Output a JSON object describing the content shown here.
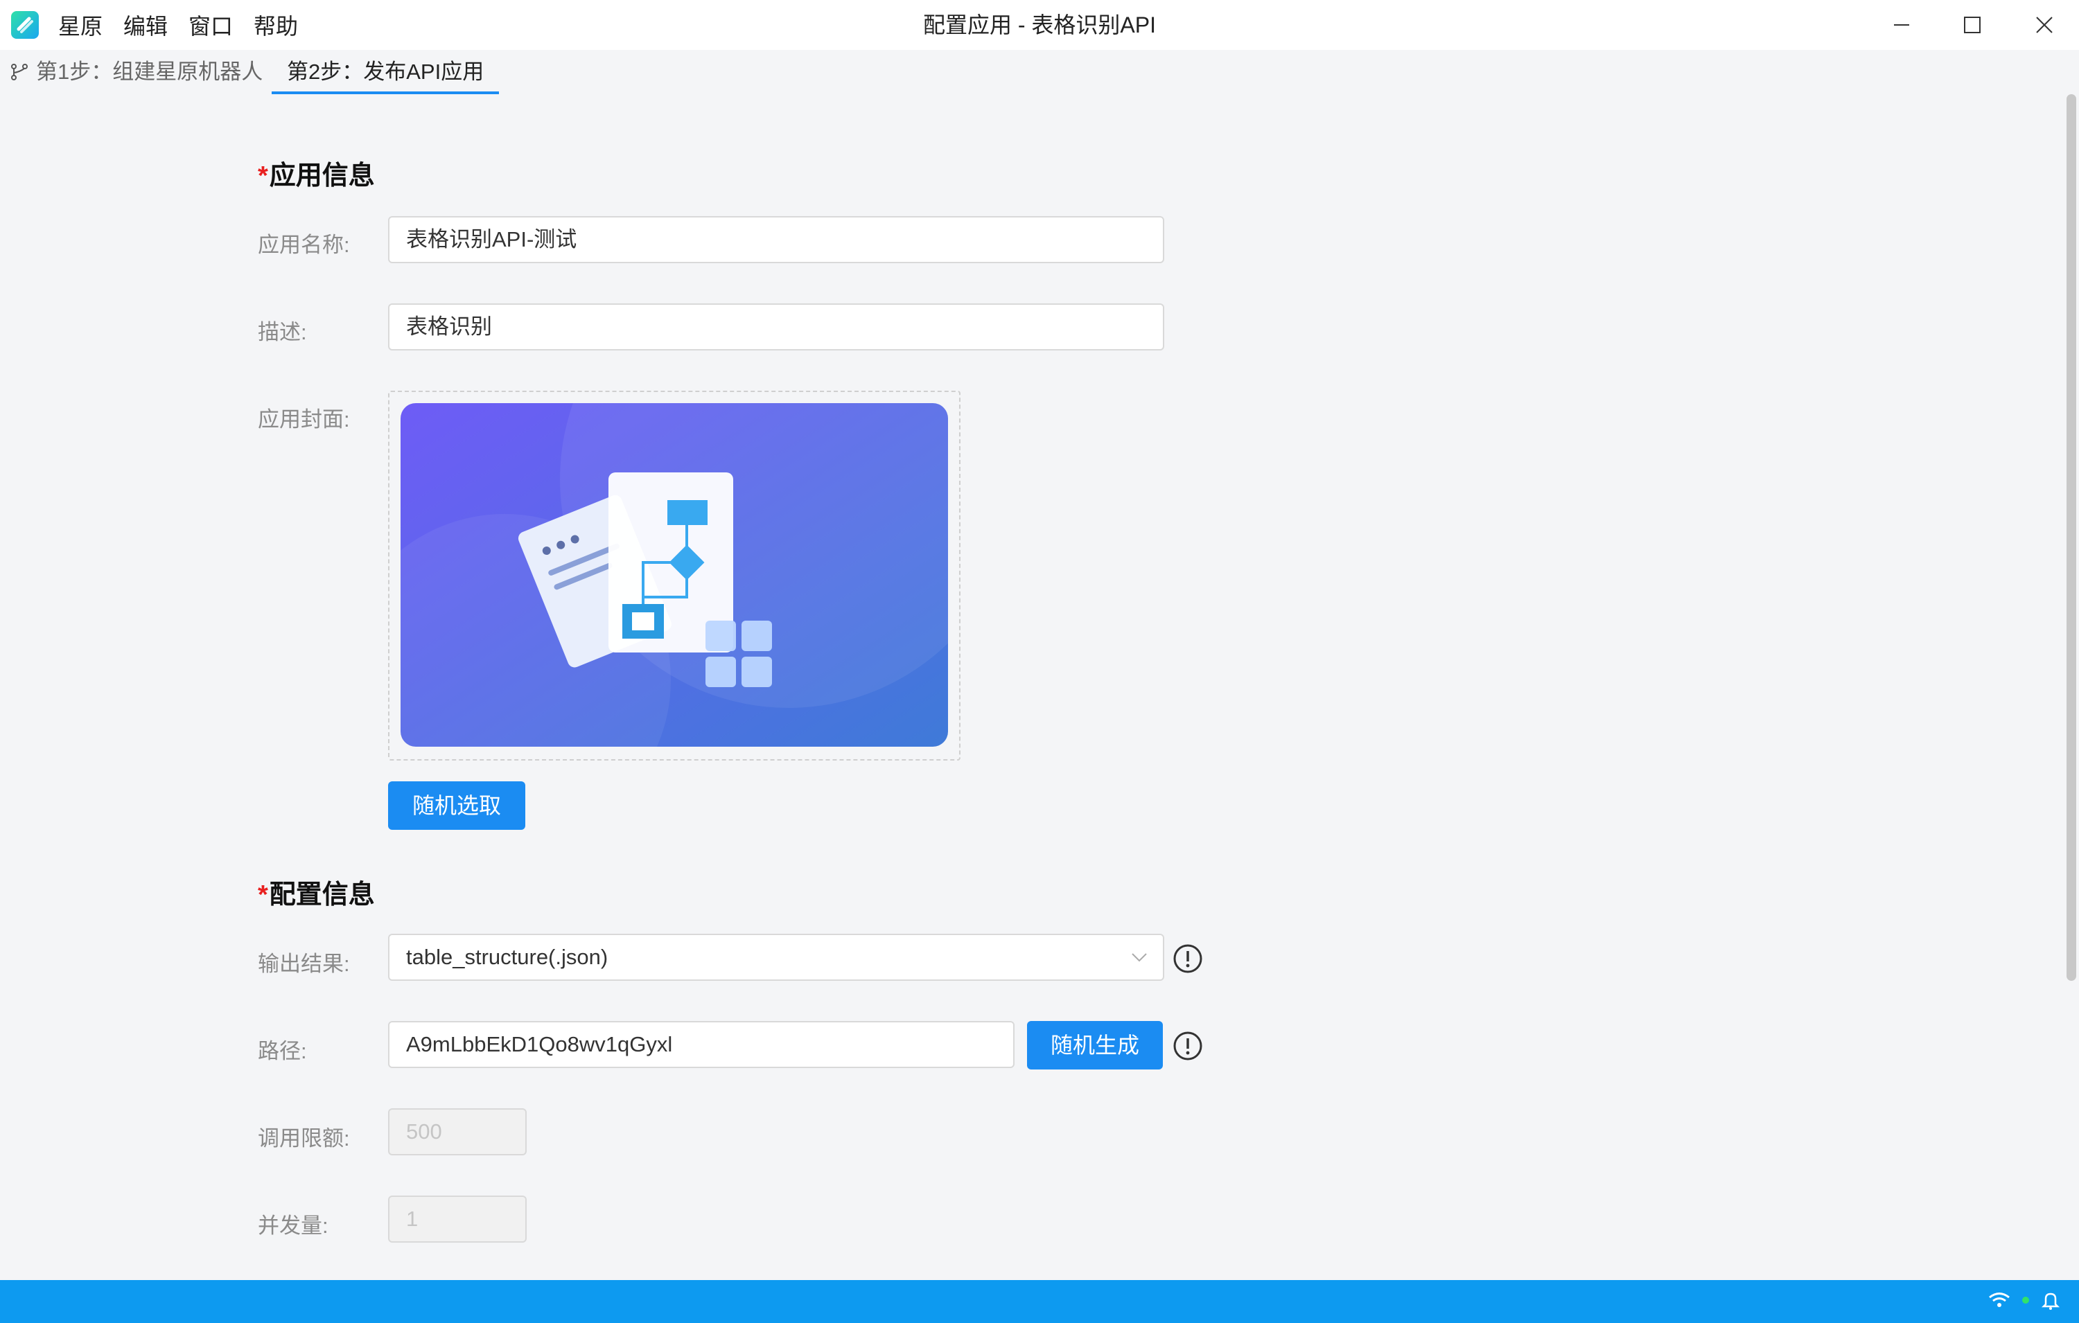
{
  "colors": {
    "accent": "#1b8cf2",
    "required": "#e82020",
    "statusbar": "#0d9af0"
  },
  "menu": [
    "星原",
    "编辑",
    "窗口",
    "帮助"
  ],
  "window_title": "配置应用 - 表格识别API",
  "tabs": [
    {
      "label": "第1步：组建星原机器人",
      "icon": "branch-icon"
    },
    {
      "label": "第2步：发布API应用"
    }
  ],
  "app_info": {
    "required_mark": "*",
    "title": "应用信息",
    "name_label": "应用名称:",
    "name_value": "表格识别API-测试",
    "desc_label": "描述:",
    "desc_value": "表格识别",
    "cover_label": "应用封面:",
    "random_pick_button": "随机选取"
  },
  "config_info": {
    "required_mark": "*",
    "title": "配置信息",
    "output_label": "输出结果:",
    "output_value": "table_structure(.json)",
    "path_label": "路径:",
    "path_value": "A9mLbbEkD1Qo8wv1qGyxl",
    "random_gen_button": "随机生成",
    "quota_label": "调用限额:",
    "quota_value": "500",
    "concurrency_label": "并发量:",
    "concurrency_value": "1"
  }
}
